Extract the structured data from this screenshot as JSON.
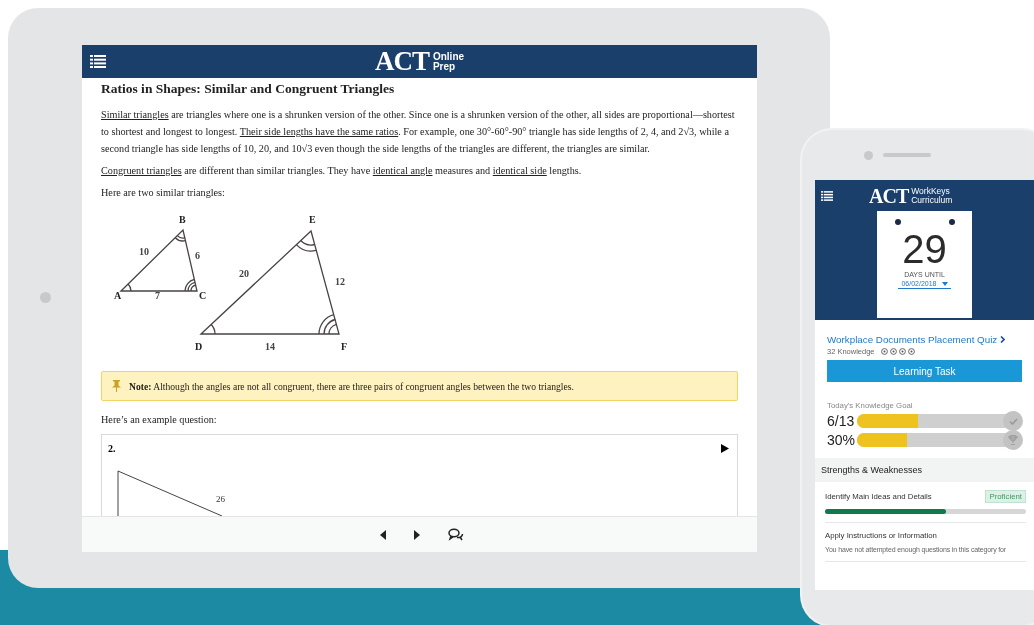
{
  "tablet": {
    "logo": "ACT",
    "logo_sub": [
      "Online",
      "Prep"
    ],
    "title": "Ratios in Shapes: Similar and Congruent Triangles",
    "paragraphs": [
      [
        {
          "text": "Similar triangles",
          "link": true
        },
        {
          "text": " are triangles where one is a shrunken version of the other. Since one is a shrunken version of the other, all sides are proportional—shortest to shortest and longest to longest. ",
          "link": false
        },
        {
          "text": "Their side lengths have the same ratios",
          "link": true
        },
        {
          "text": ". For example, one 30°-60°-90° triangle has side lengths of 2, 4, and 2√3, while a second triangle has side lengths of 10, 20, and 10√3 even though the side lengths of the triangles are different, the triangles are similar.",
          "link": false
        }
      ],
      [
        {
          "text": "Congruent triangles",
          "link": true
        },
        {
          "text": " are different than similar triangles. They have ",
          "link": false
        },
        {
          "text": "identical angle",
          "link": true
        },
        {
          "text": " measures and ",
          "link": false
        },
        {
          "text": "identical side",
          "link": true
        },
        {
          "text": " lengths.",
          "link": false
        }
      ],
      [
        {
          "text": "Here are two similar triangles:",
          "link": false
        }
      ]
    ],
    "figure": {
      "vertex_labels": [
        "A",
        "B",
        "C",
        "D",
        "E",
        "F"
      ],
      "side_labels": [
        "10",
        "6",
        "7",
        "20",
        "12",
        "14"
      ]
    },
    "note": {
      "label": "Note:",
      "text": "Although the angles are not all congruent, there are three pairs of congruent angles between the two triangles."
    },
    "after_note": "Here’s an example question:",
    "question": {
      "number": "2.",
      "side_label": "26"
    }
  },
  "phone": {
    "logo": "ACT",
    "logo_sub": [
      "WorkKeys",
      "Curriculum"
    ],
    "countdown": {
      "days": "29",
      "label": "DAYS UNTIL",
      "date": "06/02/2018"
    },
    "quiz": {
      "title": "Workplace Documents Placement Quiz",
      "knowledge": "32 Knowledge"
    },
    "button": "Learning Task",
    "goal": {
      "label": "Today's Knowledge Goal",
      "bars": [
        {
          "reading": "6/13",
          "level": 0.37,
          "kind": "check"
        },
        {
          "reading": "30%",
          "level": 0.3,
          "kind": "trophy"
        }
      ]
    },
    "strengths": {
      "title": "Strengths & Weaknesses",
      "items": [
        {
          "name": "Identify Main Ideas and Details",
          "badge": "Proficient",
          "level": 0.6
        },
        {
          "name": "Apply Instructions or Information",
          "description": "You have not attempted enough questions in this category for"
        }
      ]
    }
  }
}
